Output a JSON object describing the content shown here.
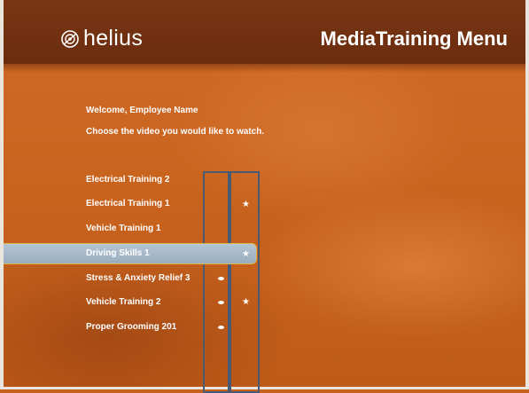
{
  "header": {
    "logo_text": "helius",
    "logo_icon": "helius-logo-icon",
    "title": "MediaTraining Menu"
  },
  "intro": {
    "welcome": "Welcome,  Employee Name",
    "prompt": "Choose the video you would like to watch."
  },
  "videos": [
    {
      "label": "Electrical Training 2",
      "dot": false,
      "star": false,
      "selected": false
    },
    {
      "label": "Electrical Training 1",
      "dot": false,
      "star": true,
      "selected": false
    },
    {
      "label": "Vehicle Training 1",
      "dot": false,
      "star": false,
      "selected": false
    },
    {
      "label": "Driving Skills 1",
      "dot": false,
      "star": true,
      "selected": true
    },
    {
      "label": "Stress & Anxiety Relief 3",
      "dot": true,
      "star": false,
      "selected": false
    },
    {
      "label": "Vehicle Training 2",
      "dot": true,
      "star": true,
      "selected": false
    },
    {
      "label": "Proper Grooming 201",
      "dot": true,
      "star": false,
      "selected": false
    }
  ],
  "colors": {
    "background": "#c76120",
    "banner": "#6a2c0e",
    "selected_row": "#a6b8c8",
    "selected_border": "#e2b64a",
    "column_outline": "#4a5a72"
  }
}
